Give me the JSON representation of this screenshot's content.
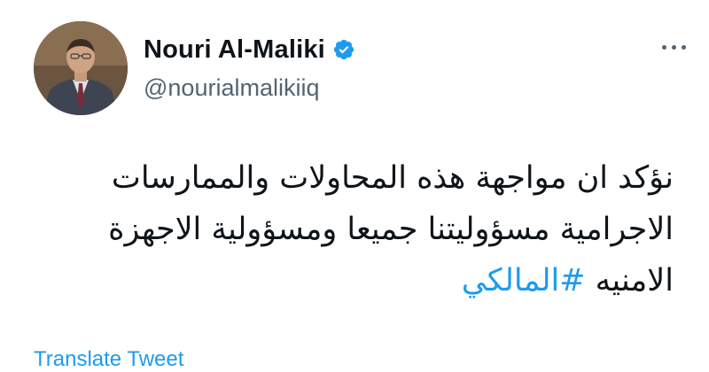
{
  "user": {
    "display_name": "Nouri Al-Maliki",
    "handle": "@nourialmalikiiq",
    "verified": true,
    "avatar_icon": "profile-photo"
  },
  "tweet": {
    "line1": "نؤكد ان مواجهة هذه المحاولات والممارسات",
    "line2": "الاجرامية مسؤوليتنا جميعا ومسؤولية الاجهزة",
    "line3_text": "الامنيه",
    "hashtag": "#المالكي"
  },
  "actions": {
    "translate_label": "Translate Tweet",
    "more_icon": "more-options-icon"
  },
  "colors": {
    "accent": "#1d9bf0",
    "text": "#0f1419",
    "secondary": "#536471"
  }
}
